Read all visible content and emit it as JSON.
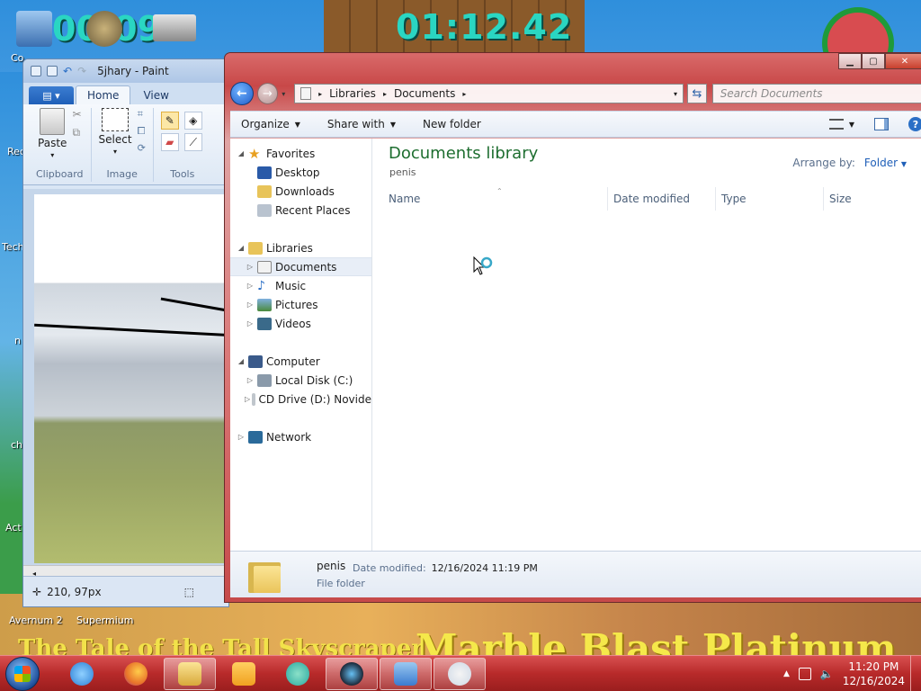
{
  "desktop": {
    "timer_main": "01:12.42",
    "timer_small": "00:09",
    "banner_left": "The Tale of the Tall Skyscraper",
    "banner_right": "Marble Blast Platinum",
    "icons": [
      {
        "label": "Co"
      },
      {
        "label": "Rec"
      },
      {
        "label": "Techn"
      },
      {
        "label": "n"
      },
      {
        "label": "ch"
      },
      {
        "label": "Act"
      },
      {
        "label": "Avernum 2"
      },
      {
        "label": "Supermium"
      }
    ]
  },
  "paint": {
    "title": "5jhary - Paint",
    "file_tab": "",
    "tabs": [
      {
        "label": "Home"
      },
      {
        "label": "View"
      }
    ],
    "groups": {
      "clipboard": {
        "label": "Clipboard",
        "paste": "Paste"
      },
      "image": {
        "label": "Image",
        "select": "Select"
      },
      "tools": {
        "label": "Tools"
      }
    },
    "status_coords": "210, 97px"
  },
  "explorer": {
    "address": {
      "crumbs": [
        "Libraries",
        "Documents"
      ]
    },
    "search_placeholder": "Search Documents",
    "commands": {
      "organize": "Organize",
      "share_with": "Share with",
      "new_folder": "New folder"
    },
    "nav": {
      "favorites": "Favorites",
      "desktop": "Desktop",
      "downloads": "Downloads",
      "recent_places": "Recent Places",
      "libraries": "Libraries",
      "documents": "Documents",
      "music": "Music",
      "pictures": "Pictures",
      "videos": "Videos",
      "computer": "Computer",
      "local_disk": "Local Disk (C:)",
      "cd_drive": "CD Drive (D:) Novide",
      "network": "Network"
    },
    "library": {
      "title": "Documents library",
      "subtitle": "penis",
      "arrange_label": "Arrange by:",
      "arrange_value": "Folder"
    },
    "columns": {
      "name": "Name",
      "date_modified": "Date modified",
      "type": "Type",
      "size": "Size"
    },
    "details": {
      "name": "penis",
      "type": "File folder",
      "modified_label": "Date modified:",
      "modified_value": "12/16/2024 11:19 PM"
    }
  },
  "taskbar": {
    "time": "11:20 PM",
    "date": "12/16/2024",
    "pinned": [
      {
        "name": "internet-explorer",
        "color": "#2b7fd6"
      },
      {
        "name": "firefox",
        "color": "#e8732a"
      },
      {
        "name": "file-explorer",
        "color": "#e8c45a"
      },
      {
        "name": "media-player",
        "color": "#f0a020"
      },
      {
        "name": "messenger",
        "color": "#2aa8a0"
      },
      {
        "name": "steam",
        "color": "#1b2838"
      },
      {
        "name": "remote-desktop",
        "color": "#3a7ad0"
      },
      {
        "name": "paint",
        "color": "#cfd9e6"
      }
    ]
  }
}
